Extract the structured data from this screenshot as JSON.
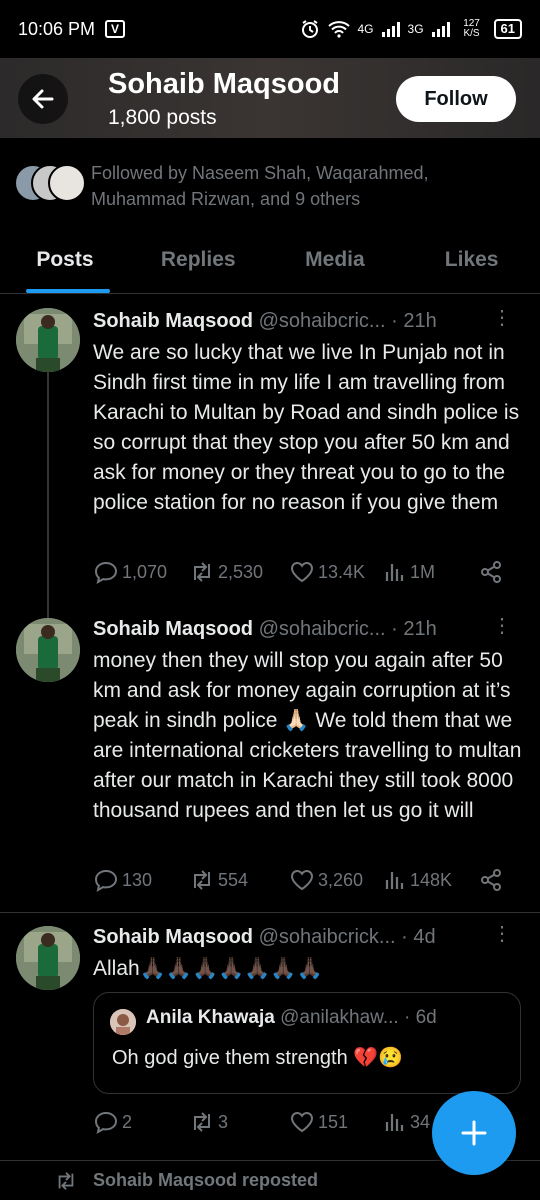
{
  "status_bar": {
    "time": "10:06 PM",
    "app_badge": "V",
    "network_1": "4G",
    "network_2": "3G",
    "speed": "127 K/S",
    "battery": "61"
  },
  "header": {
    "name": "Sohaib Maqsood",
    "posts_count": "1,800 posts",
    "follow_label": "Follow"
  },
  "followed_by": "Followed by Naseem Shah, Waqarahmed, Muhammad Rizwan, and 9 others",
  "tabs": [
    {
      "label": "Posts",
      "active": true
    },
    {
      "label": "Replies",
      "active": false
    },
    {
      "label": "Media",
      "active": false
    },
    {
      "label": "Likes",
      "active": false
    }
  ],
  "posts": [
    {
      "name": "Sohaib Maqsood",
      "handle": "@sohaibcric...",
      "time": "· 21h",
      "body": "We are so lucky that we  live In Punjab not in Sindh first time in my life I am travelling from Karachi to Multan by Road and sindh police is so corrupt that they stop you after 50 km and ask for money or they threat you to go to the police station for no reason if you give them",
      "replies": "1,070",
      "reposts": "2,530",
      "likes": "13.4K",
      "views": "1M"
    },
    {
      "name": "Sohaib Maqsood",
      "handle": "@sohaibcric...",
      "time": "· 21h",
      "body": "money then they will stop you again after 50 km and ask for money again corruption at it’s peak in sindh police 🙏🏻 We told them that we are international cricketers travelling to multan after our match in Karachi they still took 8000 thousand rupees and then let us go  it will",
      "replies": "130",
      "reposts": "554",
      "likes": "3,260",
      "views": "148K"
    },
    {
      "name": "Sohaib Maqsood",
      "handle": "@sohaibcrick...",
      "time": "· 4d",
      "body": "Allah🙏🏿🙏🏿🙏🏿🙏🏿🙏🏿🙏🏿🙏🏿",
      "replies": "2",
      "reposts": "3",
      "likes": "151",
      "views": "34"
    }
  ],
  "quote": {
    "name": "Anila Khawaja",
    "handle": "@anilakhaw...",
    "time": "· 6d",
    "body": "Oh god give them strength 💔😢"
  },
  "repost_label": "Sohaib Maqsood reposted",
  "colors": {
    "accent": "#1d9bf0",
    "muted": "#71767b",
    "text": "#e7e9ea",
    "border": "#2f3336"
  }
}
